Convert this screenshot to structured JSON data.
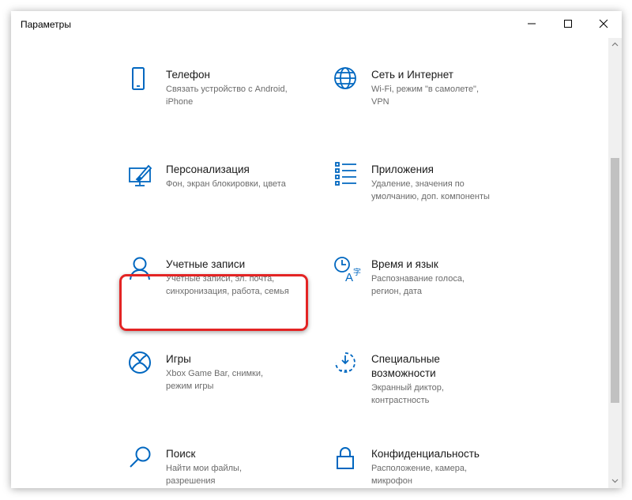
{
  "window": {
    "title": "Параметры",
    "buttons": {
      "minimize": "minimize-icon",
      "maximize": "maximize-icon",
      "close": "close-icon"
    }
  },
  "colors": {
    "accent": "#0067c0",
    "highlight": "#e32424"
  },
  "tiles": [
    {
      "title": "Телефон",
      "desc1": "Связать устройство с Android,",
      "desc2": "iPhone",
      "icon": "phone-icon"
    },
    {
      "title": "Сеть и Интернет",
      "desc1": "Wi-Fi, режим \"в самолете\",",
      "desc2": "VPN",
      "icon": "globe-icon"
    },
    {
      "title": "Персонализация",
      "desc1": "Фон, экран блокировки, цвета",
      "desc2": "",
      "icon": "personalization-icon"
    },
    {
      "title": "Приложения",
      "desc1": "Удаление, значения по",
      "desc2": "умолчанию, доп. компоненты",
      "icon": "apps-icon"
    },
    {
      "title": "Учетные записи",
      "desc1": "Учетные записи, эл. почта,",
      "desc2": "синхронизация, работа, семья",
      "icon": "person-icon"
    },
    {
      "title": "Время и язык",
      "desc1": "Распознавание голоса,",
      "desc2": "регион, дата",
      "icon": "time-language-icon"
    },
    {
      "title": "Игры",
      "desc1": "Xbox Game Bar, снимки,",
      "desc2": "режим игры",
      "icon": "xbox-icon"
    },
    {
      "title": "Специальные",
      "title2": "возможности",
      "desc1": "Экранный диктор,",
      "desc2": "контрастность",
      "icon": "accessibility-icon"
    },
    {
      "title": "Поиск",
      "desc1": "Найти мои файлы,",
      "desc2": "разрешения",
      "icon": "search-icon"
    },
    {
      "title": "Конфиденциальность",
      "desc1": "Расположение, камера,",
      "desc2": "микрофон",
      "icon": "lock-icon"
    }
  ]
}
